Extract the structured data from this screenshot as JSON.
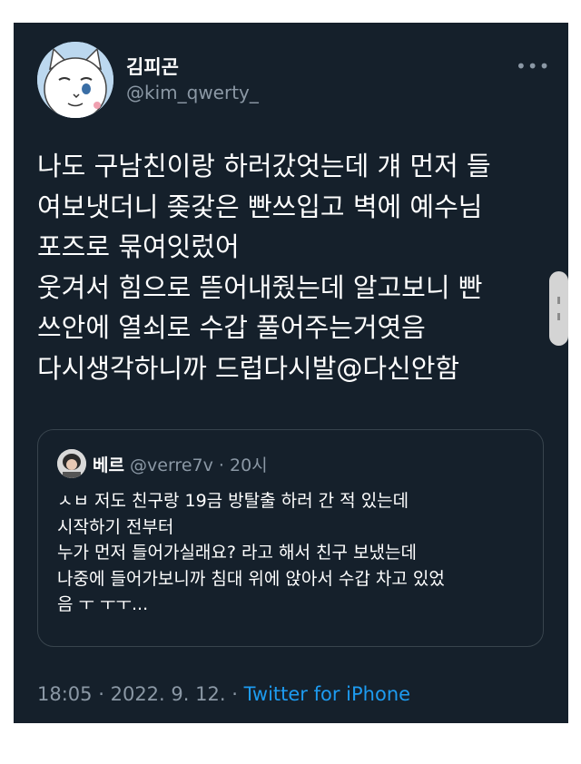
{
  "tweet": {
    "author_name": "김피곤",
    "author_handle": "@kim_qwerty_",
    "more_icon": "more-horizontal-icon",
    "lines": [
      "나도 구남친이랑 하러갔엇는데 걔 먼저 들",
      "여보냇더니 좆갗은 빤쓰입고 벽에 예수님",
      "포즈로 묶여잇렀어",
      "웃겨서 힘으로 뜯어내줬는데 알고보니 빤",
      "쓰안에 열쇠로 수갑 풀어주는거엿음",
      "다시생각하니까 드럽다시발@다신안함"
    ],
    "time": "18:05",
    "date": "2022. 9. 12.",
    "separator": "·",
    "source": "Twitter for iPhone"
  },
  "quoted": {
    "author_name": "베르",
    "author_handle": "@verre7v",
    "separator": "·",
    "time_ago": "20시",
    "lines": [
      "ㅅㅂ 저도 친구랑 19금 방탈출 하러 간 적 있는데",
      "시작하기 전부터",
      "누가 먼저 들어가실래요? 라고 해서 친구 보냈는데",
      "나중에 들어가보니까 침대 위에 앉아서 수갑 차고 있었",
      "음 ㅜ ㅜㅜ..."
    ]
  },
  "colors": {
    "background": "#15202b",
    "text": "#ffffff",
    "secondary": "#8b98a5",
    "link": "#1d9bf0",
    "border": "#38444d"
  }
}
